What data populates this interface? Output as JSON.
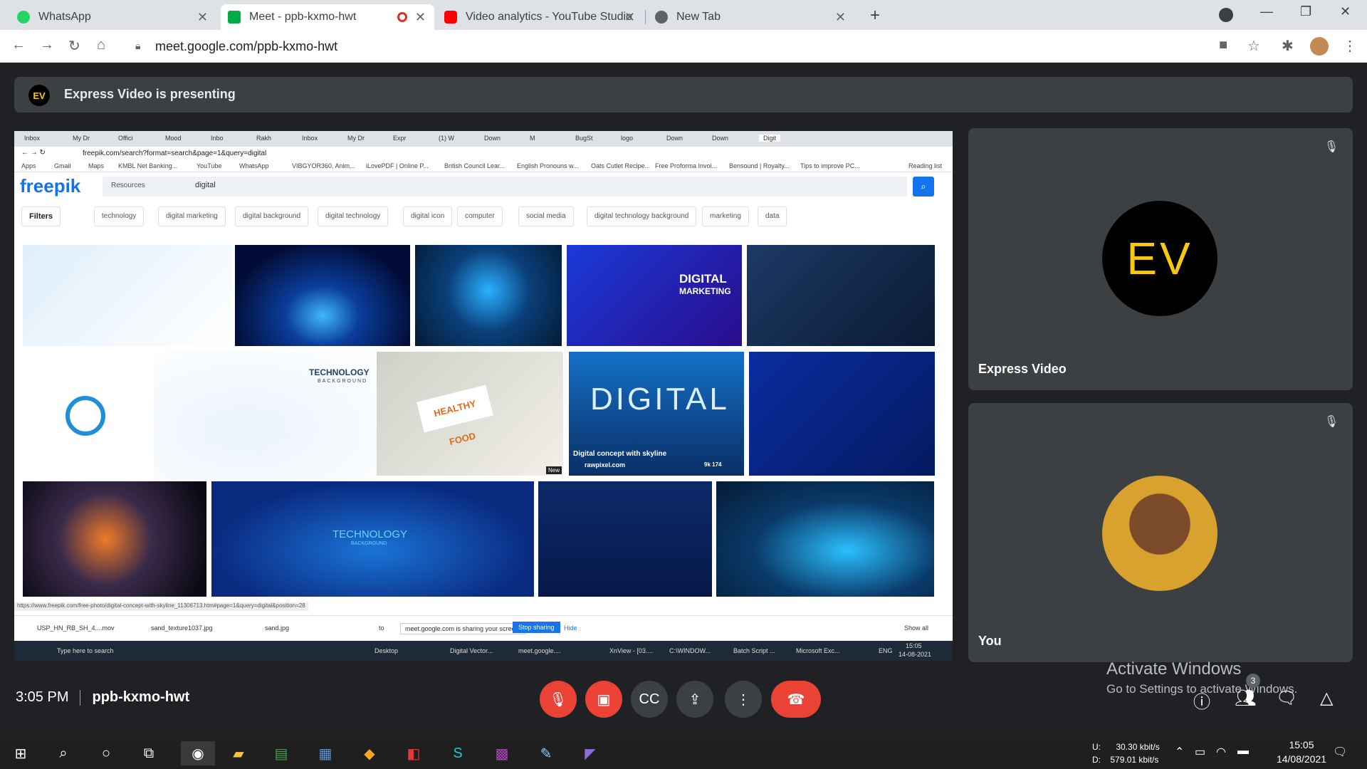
{
  "browser": {
    "tabs": [
      {
        "title": "WhatsApp",
        "color": "#25d366"
      },
      {
        "title": "Meet - ppb-kxmo-hwt",
        "color": "#00ac47"
      },
      {
        "title": "Video analytics - YouTube Studio",
        "color": "#ff0000"
      },
      {
        "title": "New Tab",
        "color": "#5f6368"
      }
    ],
    "url": "meet.google.com/ppb-kxmo-hwt"
  },
  "banner": {
    "initials": "EV",
    "text": "Express Video is presenting"
  },
  "shared_screen": {
    "inner_tabs": [
      "Inbox",
      "My Dr",
      "Offici",
      "Mood",
      "Inbo",
      "Rakh",
      "Inbox",
      "My Dr",
      "Expr",
      "(1) W",
      "Down",
      "M",
      "BugSt",
      "logo",
      "Down",
      "Down",
      "Digit"
    ],
    "address": "freepik.com/search?format=search&page=1&query=digital",
    "bookmarks": [
      "Apps",
      "Gmail",
      "Maps",
      "KMBL Net Banking...",
      "YouTube",
      "WhatsApp",
      "VIBGYOR360, Anim...",
      "iLovePDF | Online P...",
      "British Council Lear...",
      "English Pronouns w...",
      "Oats Cutlet Recipe...",
      "Free Proforma Invoi...",
      "Bensound | Royalty...",
      "Tips to improve PC...",
      "Reading list"
    ],
    "logo": "freepik",
    "resources_label": "Resources",
    "query": "digital",
    "chips": [
      "Filters",
      "technology",
      "digital marketing",
      "digital background",
      "digital technology",
      "digital icon",
      "computer",
      "social media",
      "digital technology background",
      "marketing",
      "data"
    ],
    "images": {
      "marketing_line1": "DIGITAL",
      "marketing_line2": "MARKETING",
      "tech_bg_1": "TECHNOLOGY",
      "tech_bg_1_sub": "BACKGROUND",
      "healthy": "HEALTHY FOOD",
      "new_badge": "New",
      "digital_big": "DIGITAL",
      "digital_caption": "Digital concept with skyline",
      "digital_author": "rawpixel.com",
      "digital_stats": "9k  174",
      "tech_bg_2": "TECHNOLOGY",
      "tech_bg_2_sub": "BACKGROUND"
    },
    "status_url": "https://www.freepik.com/free-photo/digital-concept-with-skyline_11306713.htm#page=1&query=digital&position=28",
    "downloads": [
      "USP_HN_RB_SH_4....mov",
      "sand_texture1037.jpg",
      "sand.jpg",
      "to"
    ],
    "sharing_text": "meet.google.com is sharing your screen.",
    "stop_sharing": "Stop sharing",
    "hide": "Hide",
    "show_all": "Show all",
    "taskbar_search": "Type here to search",
    "taskbar_items": [
      "Desktop",
      "Digital Vector...",
      "meet.google....",
      "XnView - [03....",
      "C:\\WINDOW...",
      "Batch Script ...",
      "Microsoft Exc..."
    ],
    "taskbar_lang": "ENG",
    "taskbar_time": "15:05",
    "taskbar_date": "14-08-2021"
  },
  "participants": [
    {
      "name": "Express Video",
      "initials": "EV"
    },
    {
      "name": "You"
    }
  ],
  "watermark": {
    "line1": "Activate Windows",
    "line2": "Go to Settings to activate Windows."
  },
  "meeting": {
    "time": "3:05 PM",
    "code": "ppb-kxmo-hwt",
    "people_count": "3"
  },
  "taskbar": {
    "net_up_label": "U:",
    "net_up": "30.30 kbit/s",
    "net_down_label": "D:",
    "net_down": "579.01 kbit/s",
    "time": "15:05",
    "date": "14/08/2021"
  }
}
